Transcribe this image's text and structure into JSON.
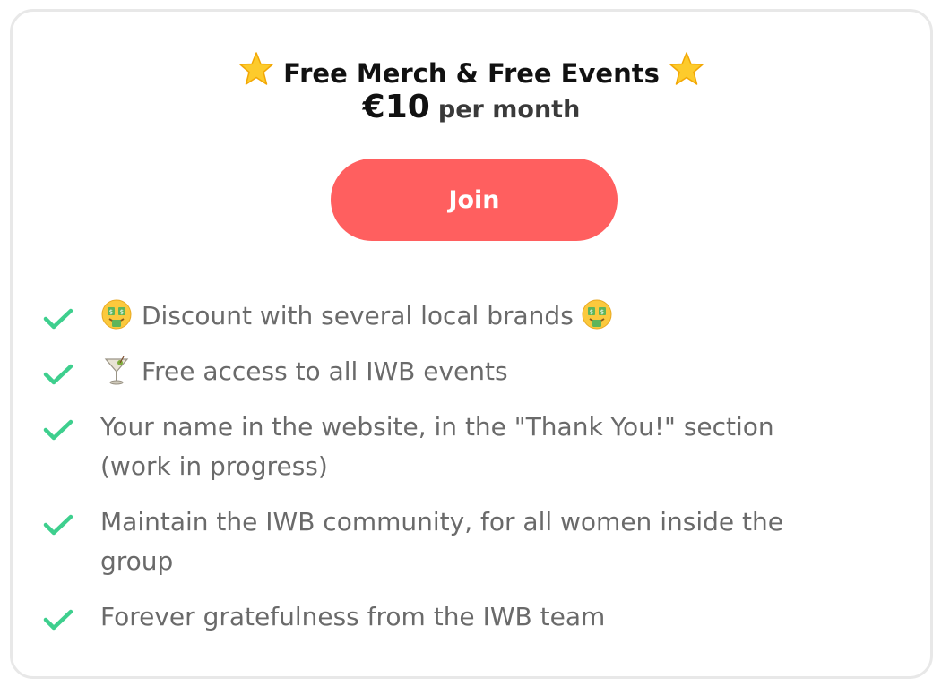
{
  "tier": {
    "title": "Free Merch & Free Events",
    "title_icons": [
      "star-icon",
      "star-icon"
    ],
    "price_amount": "€10",
    "price_period": "per month"
  },
  "join_button": {
    "label": "Join"
  },
  "benefits": [
    {
      "text": "Discount with several local brands",
      "icons": [
        "money-mouth-face-icon",
        "money-mouth-face-icon"
      ]
    },
    {
      "text": "Free access to all IWB events",
      "icons": [
        "cocktail-glass-icon"
      ]
    },
    {
      "text": "Your name in the website, in the \"Thank You!\" section (work in progress)",
      "icons": []
    },
    {
      "text": "Maintain the IWB community, for all women inside the group",
      "icons": []
    },
    {
      "text": "Forever gratefulness from the IWB team",
      "icons": []
    }
  ],
  "colors": {
    "accent": "#ff5f5f",
    "check": "#3ecf8e",
    "star": "#fdcb2c",
    "title_text": "#111111",
    "benefit_text": "#6a6a6a",
    "card_border": "#e8e8e8"
  }
}
